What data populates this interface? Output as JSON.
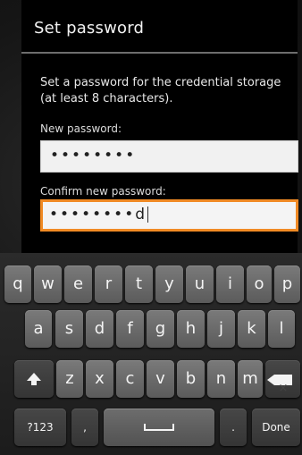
{
  "dialog": {
    "title": "Set password",
    "message": "Set a password for the credential storage (at least 8 characters).",
    "new_password": {
      "label": "New password:",
      "value": "••••••••"
    },
    "confirm_password": {
      "label": "Confirm new password:",
      "value": "••••••••",
      "typed_char": "d"
    }
  },
  "keyboard": {
    "row1": [
      "q",
      "w",
      "e",
      "r",
      "t",
      "y",
      "u",
      "i",
      "o",
      "p"
    ],
    "row2": [
      "a",
      "s",
      "d",
      "f",
      "g",
      "h",
      "j",
      "k",
      "l"
    ],
    "row3": [
      "z",
      "x",
      "c",
      "v",
      "b",
      "n",
      "m"
    ],
    "row4": {
      "symbols_label": "?123",
      "comma_label": ",",
      "period_label": ".",
      "done_label": "Done"
    },
    "icons": {
      "shift": "shift-icon",
      "backspace": "backspace-icon",
      "space": "space-icon"
    }
  },
  "colors": {
    "accent": "#f08a24",
    "dialog_bg": "#000000",
    "field_bg": "#f1f1f1"
  }
}
